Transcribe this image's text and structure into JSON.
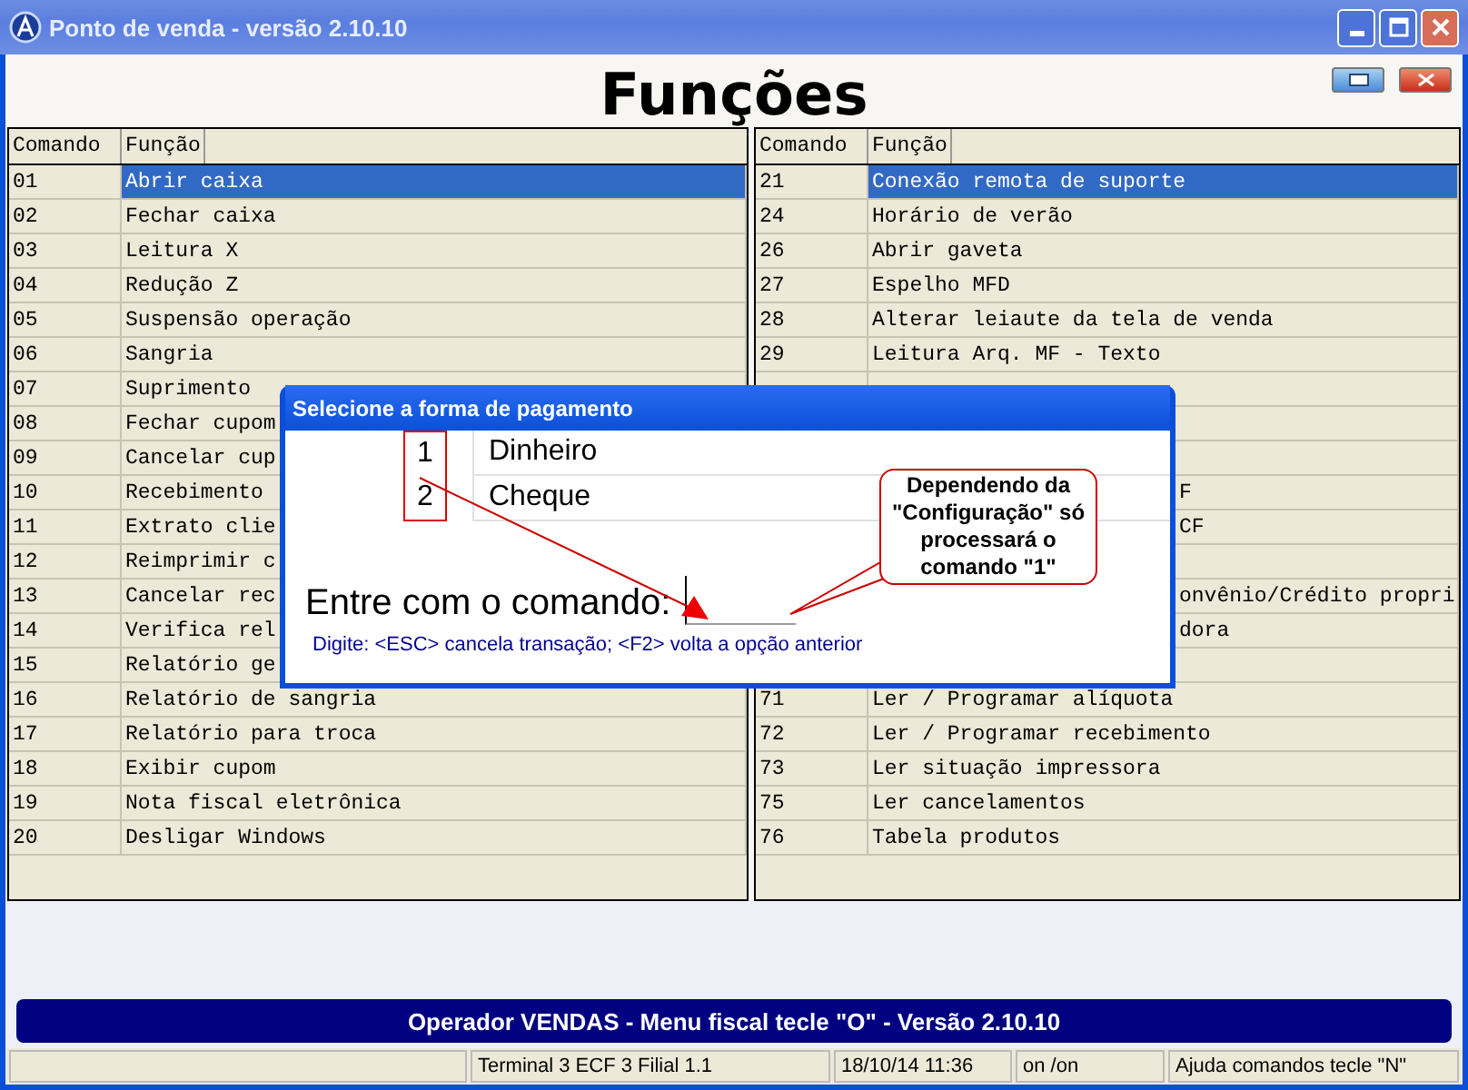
{
  "window": {
    "title": "Ponto de venda - versão 2.10.10"
  },
  "heading": "Funções",
  "left_table": {
    "columns": [
      "Comando",
      "Função"
    ],
    "rows": [
      {
        "code": "01",
        "label": "Abrir caixa",
        "selected": true
      },
      {
        "code": "02",
        "label": "Fechar caixa",
        "selected": false
      },
      {
        "code": "03",
        "label": "Leitura X",
        "selected": false
      },
      {
        "code": "04",
        "label": "Redução Z",
        "selected": false
      },
      {
        "code": "05",
        "label": "Suspensão operação",
        "selected": false
      },
      {
        "code": "06",
        "label": "Sangria",
        "selected": false
      },
      {
        "code": "07",
        "label": "Suprimento",
        "selected": false
      },
      {
        "code": "08",
        "label": "Fechar cupom",
        "selected": false
      },
      {
        "code": "09",
        "label": "Cancelar cup",
        "selected": false
      },
      {
        "code": "10",
        "label": "Recebimento",
        "selected": false
      },
      {
        "code": "11",
        "label": "Extrato clie",
        "selected": false
      },
      {
        "code": "12",
        "label": "Reimprimir c",
        "selected": false
      },
      {
        "code": "13",
        "label": "Cancelar rec",
        "selected": false
      },
      {
        "code": "14",
        "label": "Verifica rel",
        "selected": false
      },
      {
        "code": "15",
        "label": "Relatório ge",
        "selected": false
      },
      {
        "code": "16",
        "label": "Relatório de sangria",
        "selected": false
      },
      {
        "code": "17",
        "label": "Relatório para troca",
        "selected": false
      },
      {
        "code": "18",
        "label": "Exibir cupom",
        "selected": false
      },
      {
        "code": "19",
        "label": "Nota fiscal eletrônica",
        "selected": false
      },
      {
        "code": "20",
        "label": "Desligar Windows",
        "selected": false
      }
    ]
  },
  "right_table": {
    "columns": [
      "Comando",
      "Função"
    ],
    "rows": [
      {
        "kind": "row",
        "code": "21",
        "label": "Conexão remota de suporte",
        "selected": true
      },
      {
        "kind": "row",
        "code": "24",
        "label": "Horário de verão",
        "selected": false
      },
      {
        "kind": "row",
        "code": "26",
        "label": "Abrir gaveta",
        "selected": false
      },
      {
        "kind": "row",
        "code": "27",
        "label": "Espelho MFD",
        "selected": false
      },
      {
        "kind": "row",
        "code": "28",
        "label": "Alterar leiaute da tela de venda",
        "selected": false
      },
      {
        "kind": "row",
        "code": "29",
        "label": "Leitura Arq. MF - Texto",
        "selected": false
      },
      {
        "kind": "covered"
      },
      {
        "kind": "covered"
      },
      {
        "kind": "covered"
      },
      {
        "kind": "covered",
        "tail": "F"
      },
      {
        "kind": "covered",
        "tail": "CF"
      },
      {
        "kind": "covered"
      },
      {
        "kind": "covered",
        "tail": "onvênio/Crédito propri"
      },
      {
        "kind": "covered",
        "tail": "dora"
      },
      {
        "kind": "covered"
      },
      {
        "kind": "row",
        "code": "71",
        "label": "Ler / Programar alíquota",
        "selected": false
      },
      {
        "kind": "row",
        "code": "72",
        "label": "Ler / Programar recebimento",
        "selected": false
      },
      {
        "kind": "row",
        "code": "73",
        "label": "Ler situação impressora",
        "selected": false
      },
      {
        "kind": "row",
        "code": "75",
        "label": "Ler cancelamentos",
        "selected": false
      },
      {
        "kind": "row",
        "code": "76",
        "label": "Tabela produtos",
        "selected": false
      }
    ]
  },
  "dialog": {
    "title": "Selecione a forma de pagamento",
    "options": [
      {
        "number": "1",
        "label": "Dinheiro"
      },
      {
        "number": "2",
        "label": "Cheque"
      }
    ],
    "prompt": "Entre com o comando:",
    "hint": "Digite: <ESC> cancela transação; <F2> volta a opção anterior",
    "callout": "Dependendo da \"Configuração\" só processará o comando \"1\""
  },
  "banner": "Operador VENDAS - Menu fiscal tecle \"O\" - Versão 2.10.10",
  "status_bar": [
    "Terminal 3 ECF 3 Filial 1.1",
    "18/10/14 11:36",
    "on /on",
    "Ajuda comandos tecle \"N\""
  ]
}
